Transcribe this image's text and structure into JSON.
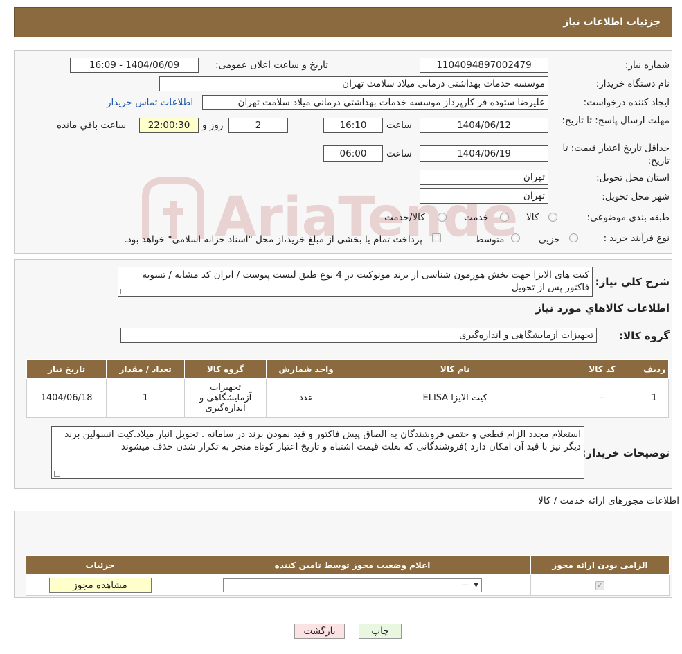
{
  "header": {
    "title": "جزئیات اطلاعات نیاز"
  },
  "details": {
    "need_number_label": "شماره نیاز:",
    "need_number": "1104094897002479",
    "announce_label": "تاریخ و ساعت اعلان عمومی:",
    "announce_value": "1404/06/09 - 16:09",
    "buyer_org_label": "نام دستگاه خریدار:",
    "buyer_org": "موسسه خدمات بهداشتی درمانی میلاد سلامت تهران",
    "requester_label": "ایجاد کننده درخواست:",
    "requester": "علیرضا ستوده فر کارپرداز موسسه خدمات بهداشتی درمانی میلاد سلامت تهران",
    "contact_link": "اطلاعات تماس خریدار",
    "deadline_label": "مهلت ارسال پاسخ: تا تاریخ:",
    "deadline_date": "1404/06/12",
    "time_label": "ساعت",
    "deadline_time": "16:10",
    "days_value": "2",
    "days_label": "روز و",
    "remaining_value": "22:00:30",
    "remaining_label": "ساعت باقي مانده",
    "validity_label": "حداقل تاریخ اعتبار قیمت: تا تاریخ:",
    "validity_date": "1404/06/19",
    "validity_time": "06:00",
    "province_label": "استان محل تحویل:",
    "province": "تهران",
    "city_label": "شهر محل تحویل:",
    "city": "تهران",
    "category_label": "طبقه بندی موضوعی:",
    "category_options": [
      "کالا",
      "خدمت",
      "کالا/خدمت"
    ],
    "process_label": "نوع فرآیند خرید :",
    "process_options": [
      "جزیی",
      "متوسط"
    ],
    "process_note": "پرداخت تمام یا بخشی از مبلغ خرید،از محل \"اسناد خزانه اسلامی\" خواهد بود."
  },
  "description": {
    "label": "شرح کلي نياز:",
    "text": "کیت های الایزا جهت بخش هورمون شناسی از برند مونوکیت در 4 نوع طبق لیست پیوست / ایران کد مشابه / تسویه فاکتور پس از تحویل"
  },
  "goods": {
    "section_title": "اطلاعات کالاهاي مورد نياز",
    "group_label": "گروه کالا:",
    "group_value": "تجهیزات آزمایشگاهی و اندازه‌گیری",
    "columns": [
      "رديف",
      "کد کالا",
      "نام کالا",
      "واحد شمارش",
      "گروه کالا",
      "تعداد / مقدار",
      "تاريخ نياز"
    ],
    "rows": [
      {
        "row": "1",
        "code": "--",
        "name": "کیت الایزا ELISA",
        "unit": "عدد",
        "group": "تجهیزات آزمایشگاهی و اندازه‌گیری",
        "qty": "1",
        "date": "1404/06/18"
      }
    ]
  },
  "buyer_notes": {
    "label": "توضیحات خریدار:",
    "text": "استعلام مجدد الزام قطعی و حتمی فروشندگان  به الصاق پیش فاکتور و قید نمودن برند در سامانه  . تحویل انبار میلاد.کیت انسولین برند دیگر نیز با قید آن  امکان دارد )فروشندگانی که بعلت قیمت اشتباه و تاریخ اعتبار کوتاه منجر به تکرار شدن حذف میشوند"
  },
  "permits": {
    "section_title": "اطلاعات مجوزهای ارائه خدمت / کالا",
    "columns": [
      "الزامی بودن ارائه مجوز",
      "اعلام وضعیت مجوز توسط تامین کننده",
      "جزئیات"
    ],
    "select_value": "--",
    "view_button": "مشاهده مجوز"
  },
  "footer": {
    "print_button": "چاپ",
    "back_button": "بازگشت"
  },
  "watermark": {
    "text": "AriaTender.neT"
  }
}
